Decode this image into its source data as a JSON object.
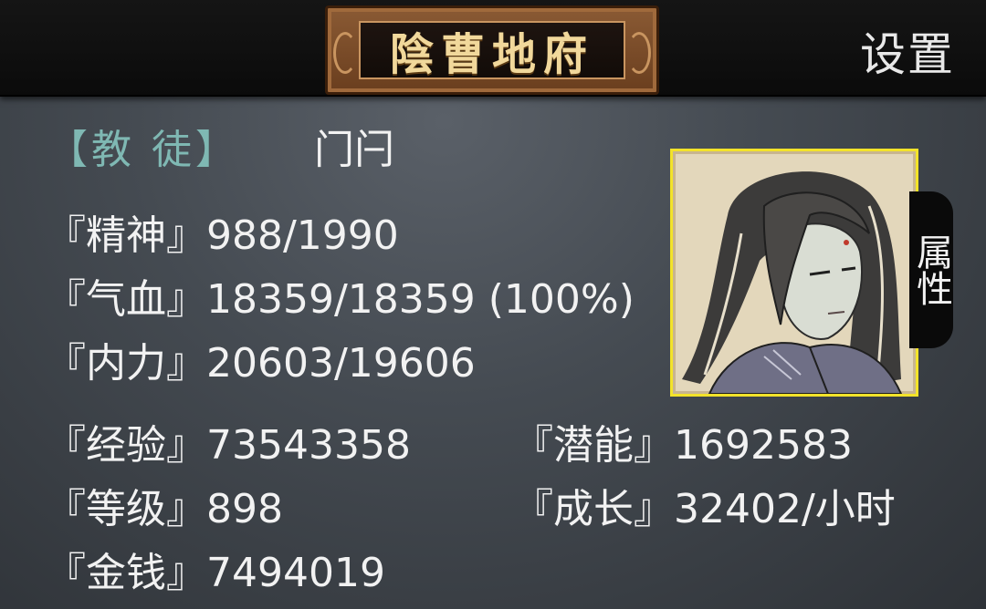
{
  "header": {
    "title": "陰曹地府",
    "settings_label": "设置"
  },
  "role": {
    "tag": "【教 徒】",
    "name": "门闩"
  },
  "stats": {
    "spirit_label": "『精神』",
    "spirit_value": "988/1990",
    "hp_label": "『气血』",
    "hp_value": "18359/18359 (100%)",
    "mp_label": "『内力』",
    "mp_value": "20603/19606",
    "exp_label": "『经验』",
    "exp_value": "73543358",
    "potential_label": "『潜能』",
    "potential_value": "1692583",
    "level_label": "『等级』",
    "level_value": "898",
    "growth_label": "『成长』",
    "growth_value": "32402/小时",
    "money_label": "『金钱』",
    "money_value": "7494019"
  },
  "side_tab": {
    "label": "属性"
  },
  "colors": {
    "role_tag": "#7fb8b3",
    "title_text": "#f1d89b",
    "portrait_border": "#f3e32a"
  }
}
